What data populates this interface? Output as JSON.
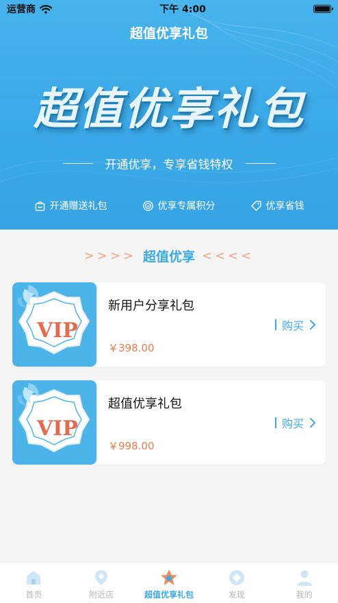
{
  "status_bar": {
    "carrier": "运营商",
    "time": "下午 4:00"
  },
  "nav": {
    "title": "超值优享礼包"
  },
  "banner": {
    "headline": "超值优享礼包",
    "subtitle": "开通优享，专享省钱特权"
  },
  "perks": [
    {
      "icon": "gift-bag-icon",
      "label": "开通赠送礼包"
    },
    {
      "icon": "points-badge-icon",
      "label": "优享专属积分"
    },
    {
      "icon": "price-tag-icon",
      "label": "优享省钱"
    }
  ],
  "section": {
    "title": "超值优享"
  },
  "packages": [
    {
      "title": "新用户分享礼包",
      "price": "￥398.00",
      "buy_label": "购买",
      "badge_text": "VIP"
    },
    {
      "title": "超值优享礼包",
      "price": "￥998.00",
      "buy_label": "购买",
      "badge_text": "VIP"
    }
  ],
  "tabs": [
    {
      "icon": "home-icon",
      "label": "首页",
      "active": false
    },
    {
      "icon": "location-pin-icon",
      "label": "附近店",
      "active": false
    },
    {
      "icon": "star-icon",
      "label": "超值优享礼包",
      "active": true
    },
    {
      "icon": "discover-icon",
      "label": "发现",
      "active": false
    },
    {
      "icon": "user-icon",
      "label": "我的",
      "active": false
    }
  ],
  "colors": {
    "brand_blue": "#3aa9e8",
    "price_orange": "#ef7a48",
    "tab_inactive": "#b5b5b5"
  }
}
